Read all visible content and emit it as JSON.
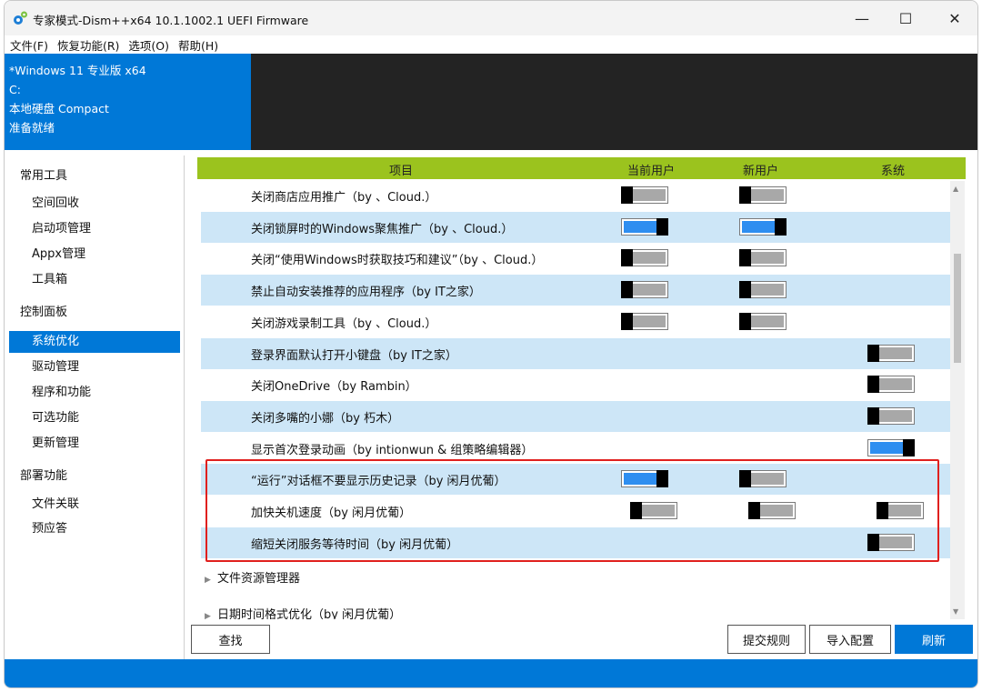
{
  "window": {
    "title": "专家模式-Dism++x64 10.1.1002.1 UEFI Firmware",
    "minimize": "—",
    "maximize": "☐",
    "close": "✕"
  },
  "menu": [
    "文件(F)",
    "恢复功能(R)",
    "选项(O)",
    "帮助(H)"
  ],
  "info": {
    "os": "*Windows 11 专业版 x64",
    "drive": "C:",
    "disk": "本地硬盘 Compact",
    "status": "准备就绪"
  },
  "sidebar": {
    "groups": [
      {
        "label": "常用工具",
        "items": [
          "空间回收",
          "启动项管理",
          "Appx管理",
          "工具箱"
        ]
      },
      {
        "label": "控制面板",
        "items": [
          "系统优化",
          "驱动管理",
          "程序和功能",
          "可选功能",
          "更新管理"
        ]
      },
      {
        "label": "部署功能",
        "items": [
          "文件关联",
          "预应答"
        ]
      }
    ],
    "active": "系统优化"
  },
  "table": {
    "headers": [
      "项目",
      "当前用户",
      "新用户",
      "系统"
    ],
    "rows": [
      {
        "label": "关闭商店应用推广（by 、Cloud.）",
        "current": "off",
        "new": "off",
        "system": null
      },
      {
        "label": "关闭锁屏时的Windows聚焦推广（by 、Cloud.）",
        "current": "on",
        "new": "on",
        "system": null
      },
      {
        "label": "关闭“使用Windows时获取技巧和建议”（by 、Cloud.）",
        "current": "off",
        "new": "off",
        "system": null
      },
      {
        "label": "禁止自动安装推荐的应用程序（by IT之家）",
        "current": "off",
        "new": "off",
        "system": null
      },
      {
        "label": "关闭游戏录制工具（by 、Cloud.）",
        "current": "off",
        "new": "off",
        "system": null
      },
      {
        "label": "登录界面默认打开小键盘（by IT之家）",
        "current": null,
        "new": null,
        "system": "off"
      },
      {
        "label": "关闭OneDrive（by Rambin）",
        "current": null,
        "new": null,
        "system": "off"
      },
      {
        "label": "关闭多嘴的小娜（by 朽木）",
        "current": null,
        "new": null,
        "system": "off"
      },
      {
        "label": "显示首次登录动画（by intionwun & 组策略编辑器）",
        "current": null,
        "new": null,
        "system": "on"
      },
      {
        "label": "“运行”对话框不要显示历史记录（by 闲月优葡）",
        "current": "on",
        "new": "off",
        "system": null
      },
      {
        "label": "加快关机速度（by 闲月优葡）",
        "current": "off",
        "new": "off",
        "system": "off"
      },
      {
        "label": "缩短关闭服务等待时间（by 闲月优葡）",
        "current": null,
        "new": null,
        "system": "off"
      }
    ],
    "tree": [
      "文件资源管理器",
      "日期时间格式优化（by 闲月优葡）"
    ]
  },
  "buttons": {
    "find": "查找",
    "submit": "提交规则",
    "import": "导入配置",
    "refresh": "刷新"
  },
  "colors": {
    "accent": "#0078d7",
    "header": "#9bc31e",
    "row_alt": "#cde6f7",
    "toggle_on": "#2e8ef0",
    "highlight": "#e0201e"
  },
  "icons": {
    "app": "gears-icon",
    "tree": "triangle-right-icon",
    "scroll_up": "triangle-up-icon",
    "scroll_down": "triangle-down-icon"
  }
}
